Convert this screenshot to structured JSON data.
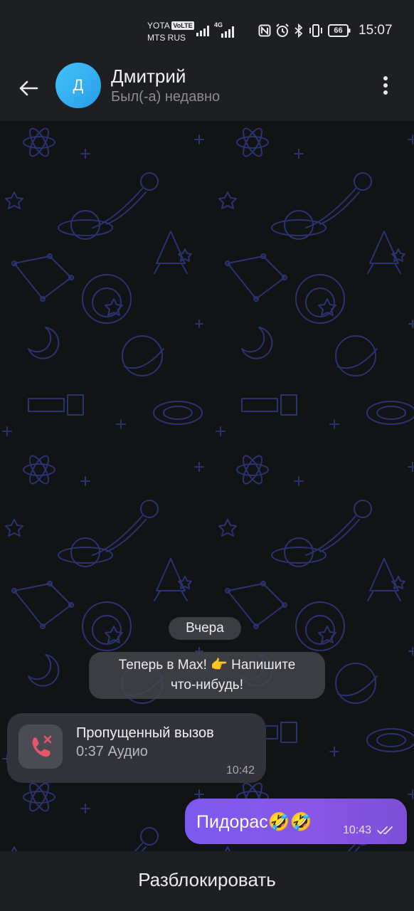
{
  "status_bar": {
    "carrier_line1": "YOTA",
    "volte_badge": "VoLTE",
    "carrier_line2": "MTS RUS",
    "network_type": "4G",
    "battery_level": "66",
    "time": "15:07",
    "icons": [
      "signal-icon",
      "data-signal-icon",
      "nfc-icon",
      "alarm-icon",
      "bluetooth-icon",
      "vibrate-icon",
      "battery-icon"
    ]
  },
  "header": {
    "avatar_letter": "Д",
    "contact_name": "Дмитрий",
    "contact_status": "Был(-а) недавно",
    "colors": {
      "avatar_from": "#41c3f5",
      "avatar_to": "#2a9cec"
    }
  },
  "chat": {
    "date_separator": "Вчера",
    "system_message": {
      "line1": "Теперь в Max! 👉 Напишите",
      "line2": "что-нибудь!"
    },
    "missed_call": {
      "title": "Пропущенный вызов",
      "subtitle": "0:37 Аудио",
      "time": "10:42",
      "icon_color": "#e6556a"
    },
    "outgoing_message": {
      "text": "Пидорас🤣🤣",
      "time": "10:43",
      "status_icon": "double-check-icon",
      "colors": {
        "from": "#7c5af0",
        "to": "#7d4fd6"
      }
    }
  },
  "bottom_bar": {
    "unblock_label": "Разблокировать"
  }
}
